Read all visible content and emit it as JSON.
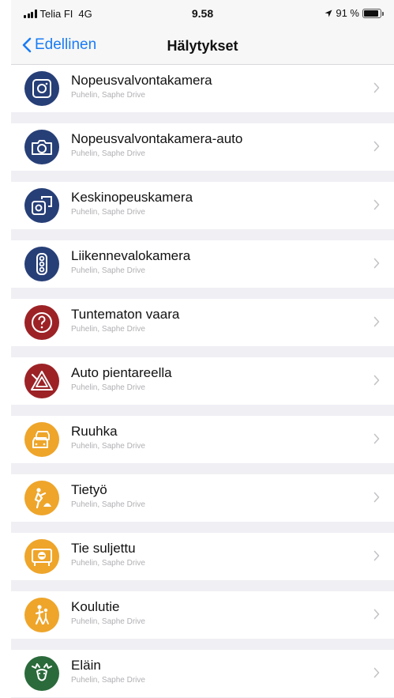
{
  "status": {
    "carrier": "Telia FI",
    "network": "4G",
    "time": "9.58",
    "battery_text": "91 %",
    "battery_level": 0.91
  },
  "nav": {
    "back_label": "Edellinen",
    "title": "Hälytykset"
  },
  "items": [
    {
      "title": "Nopeusvalvontakamera",
      "subtitle": "Puhelin, Saphe Drive",
      "icon": "speed-camera-icon",
      "color": "#273f77"
    },
    {
      "title": "Nopeusvalvontakamera-auto",
      "subtitle": "Puhelin, Saphe Drive",
      "icon": "camera-car-icon",
      "color": "#273f77"
    },
    {
      "title": "Keskinopeuskamera",
      "subtitle": "Puhelin, Saphe Drive",
      "icon": "average-speed-camera-icon",
      "color": "#273f77"
    },
    {
      "title": "Liikennevalokamera",
      "subtitle": "Puhelin, Saphe Drive",
      "icon": "traffic-light-camera-icon",
      "color": "#273f77"
    },
    {
      "title": "Tuntematon vaara",
      "subtitle": "Puhelin, Saphe Drive",
      "icon": "unknown-danger-icon",
      "color": "#9c2226"
    },
    {
      "title": "Auto pientareella",
      "subtitle": "Puhelin, Saphe Drive",
      "icon": "car-on-shoulder-icon",
      "color": "#9c2226"
    },
    {
      "title": "Ruuhka",
      "subtitle": "Puhelin, Saphe Drive",
      "icon": "traffic-jam-icon",
      "color": "#eea52a"
    },
    {
      "title": "Tietyö",
      "subtitle": "Puhelin, Saphe Drive",
      "icon": "roadwork-icon",
      "color": "#eea52a"
    },
    {
      "title": "Tie suljettu",
      "subtitle": "Puhelin, Saphe Drive",
      "icon": "road-closed-icon",
      "color": "#eea52a"
    },
    {
      "title": "Koulutie",
      "subtitle": "Puhelin, Saphe Drive",
      "icon": "school-road-icon",
      "color": "#eea52a"
    },
    {
      "title": "Eläin",
      "subtitle": "Puhelin, Saphe Drive",
      "icon": "animal-icon",
      "color": "#2b6a3b"
    }
  ]
}
